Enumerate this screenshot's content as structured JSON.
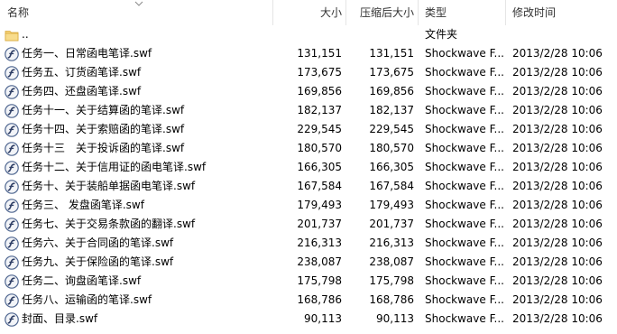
{
  "header": {
    "name": "名称",
    "size": "大小",
    "compressed": "压缩后大小",
    "type": "类型",
    "modified": "修改时间"
  },
  "parent": {
    "name": "..",
    "type": "文件夹"
  },
  "files": [
    {
      "name": "任务一、日常函电笔译.swf",
      "size": "131,151",
      "compressed": "131,151",
      "type": "Shockwave F...",
      "modified": "2013/2/28 10:06"
    },
    {
      "name": "任务五、订货函笔译.swf",
      "size": "173,675",
      "compressed": "173,675",
      "type": "Shockwave F...",
      "modified": "2013/2/28 10:06"
    },
    {
      "name": "任务四、还盘函笔译.swf",
      "size": "169,856",
      "compressed": "169,856",
      "type": "Shockwave F...",
      "modified": "2013/2/28 10:06"
    },
    {
      "name": "任务十一、关于结算函的笔译.swf",
      "size": "182,137",
      "compressed": "182,137",
      "type": "Shockwave F...",
      "modified": "2013/2/28 10:06"
    },
    {
      "name": "任务十四、关于索赔函的笔译.swf",
      "size": "229,545",
      "compressed": "229,545",
      "type": "Shockwave F...",
      "modified": "2013/2/28 10:06"
    },
    {
      "name": "任务十三　关于投诉函的笔译.swf",
      "size": "180,570",
      "compressed": "180,570",
      "type": "Shockwave F...",
      "modified": "2013/2/28 10:06"
    },
    {
      "name": "任务十二、关于信用证的函电笔译.swf",
      "size": "166,305",
      "compressed": "166,305",
      "type": "Shockwave F...",
      "modified": "2013/2/28 10:06"
    },
    {
      "name": "任务十、关于装船单据函电笔译.swf",
      "size": "167,584",
      "compressed": "167,584",
      "type": "Shockwave F...",
      "modified": "2013/2/28 10:06"
    },
    {
      "name": "任务三、 发盘函笔译.swf",
      "size": "179,493",
      "compressed": "179,493",
      "type": "Shockwave F...",
      "modified": "2013/2/28 10:06"
    },
    {
      "name": "任务七、关于交易条款函的翻译.swf",
      "size": "201,737",
      "compressed": "201,737",
      "type": "Shockwave F...",
      "modified": "2013/2/28 10:06"
    },
    {
      "name": "任务六、关于合同函的笔译.swf",
      "size": "216,313",
      "compressed": "216,313",
      "type": "Shockwave F...",
      "modified": "2013/2/28 10:06"
    },
    {
      "name": "任务九、关于保险函的笔译.swf",
      "size": "238,087",
      "compressed": "238,087",
      "type": "Shockwave F...",
      "modified": "2013/2/28 10:06"
    },
    {
      "name": "任务二、询盘函笔译.swf",
      "size": "175,798",
      "compressed": "175,798",
      "type": "Shockwave F...",
      "modified": "2013/2/28 10:06"
    },
    {
      "name": "任务八、运输函的笔译.swf",
      "size": "168,786",
      "compressed": "168,786",
      "type": "Shockwave F...",
      "modified": "2013/2/28 10:06"
    },
    {
      "name": "封面、目录.swf",
      "size": "90,113",
      "compressed": "90,113",
      "type": "Shockwave F...",
      "modified": "2013/2/28 10:06"
    }
  ],
  "icons": {
    "folder": "folder-icon",
    "file": "flash-file-icon",
    "sort": "sort-ascending-icon"
  },
  "colors": {
    "folder": "#f5d27a",
    "file_icon_bg": "#5a6f9a",
    "header_text": "#333333"
  }
}
